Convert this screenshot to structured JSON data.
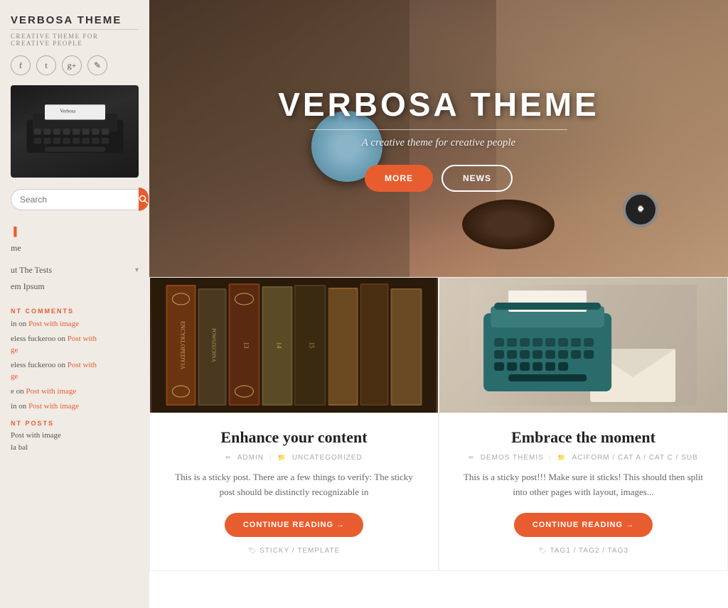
{
  "sidebar": {
    "title": "VERBOSA THEME",
    "subtitle": "CREATIVE THEME FOR CREATIVE PEOPLE",
    "social_icons": [
      "f",
      "t",
      "g+",
      "✎"
    ],
    "search_placeholder": "Search",
    "search_button_label": "🔍",
    "nav_items": [
      {
        "label": "",
        "color": "orange"
      },
      {
        "label": "me"
      },
      {
        "label": ""
      },
      {
        "label": "ut The Tests",
        "has_dropdown": true
      },
      {
        "label": "em Ipsum"
      }
    ],
    "recent_comments_title": "NT COMMENTS",
    "comments": [
      {
        "text": "in on Post with image"
      },
      {
        "text": "eless fuckeroo on Post with\nge"
      },
      {
        "text": "eless fuckeroo on Post with\nge"
      },
      {
        "text": "e on Post with image"
      },
      {
        "text": "in on Post with image"
      }
    ],
    "recent_posts_title": "NT POSTS",
    "posts": [
      {
        "label": "Post with image"
      },
      {
        "label": "la bal"
      }
    ]
  },
  "hero": {
    "title": "VERBOSA THEME",
    "subtitle": "A creative theme for creative people",
    "btn_more": "MORE",
    "btn_news": "NEWS"
  },
  "posts": [
    {
      "title": "Enhance your content",
      "author": "ADMIN",
      "category": "UNCATEGORIZED",
      "excerpt": "This is a sticky post. There are a few things to verify: The sticky post should be distinctly recognizable in",
      "continue_label": "CONTINUE READING →",
      "tags": "STICKY / TEMPLATE",
      "image_type": "books"
    },
    {
      "title": "Embrace the moment",
      "author": "DEMOS THEMIS",
      "category": "ACIFORM / CAT A / CAT C / SUB",
      "excerpt": "This is a sticky post!!! Make sure it sticks! This should then split into other pages with layout, images...",
      "continue_label": "CONTINUE READING →",
      "tags": "TAG1 / TAG2 / TAG3",
      "image_type": "typewriter"
    }
  ],
  "colors": {
    "accent": "#e85d2f",
    "text_dark": "#222",
    "text_mid": "#666",
    "text_light": "#aaa"
  }
}
